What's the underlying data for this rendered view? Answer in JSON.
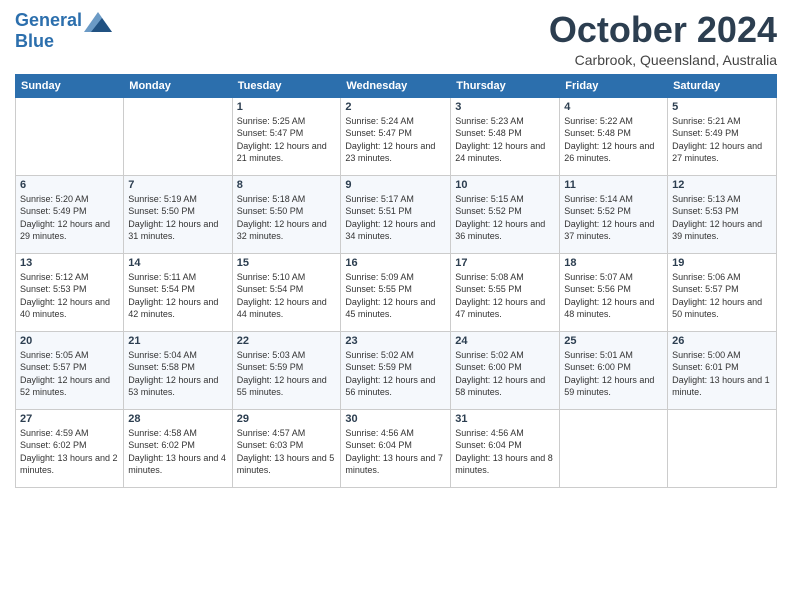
{
  "header": {
    "logo_line1": "General",
    "logo_line2": "Blue",
    "month": "October 2024",
    "location": "Carbrook, Queensland, Australia"
  },
  "weekdays": [
    "Sunday",
    "Monday",
    "Tuesday",
    "Wednesday",
    "Thursday",
    "Friday",
    "Saturday"
  ],
  "weeks": [
    [
      {
        "num": "",
        "info": ""
      },
      {
        "num": "",
        "info": ""
      },
      {
        "num": "1",
        "info": "Sunrise: 5:25 AM\nSunset: 5:47 PM\nDaylight: 12 hours and 21 minutes."
      },
      {
        "num": "2",
        "info": "Sunrise: 5:24 AM\nSunset: 5:47 PM\nDaylight: 12 hours and 23 minutes."
      },
      {
        "num": "3",
        "info": "Sunrise: 5:23 AM\nSunset: 5:48 PM\nDaylight: 12 hours and 24 minutes."
      },
      {
        "num": "4",
        "info": "Sunrise: 5:22 AM\nSunset: 5:48 PM\nDaylight: 12 hours and 26 minutes."
      },
      {
        "num": "5",
        "info": "Sunrise: 5:21 AM\nSunset: 5:49 PM\nDaylight: 12 hours and 27 minutes."
      }
    ],
    [
      {
        "num": "6",
        "info": "Sunrise: 5:20 AM\nSunset: 5:49 PM\nDaylight: 12 hours and 29 minutes."
      },
      {
        "num": "7",
        "info": "Sunrise: 5:19 AM\nSunset: 5:50 PM\nDaylight: 12 hours and 31 minutes."
      },
      {
        "num": "8",
        "info": "Sunrise: 5:18 AM\nSunset: 5:50 PM\nDaylight: 12 hours and 32 minutes."
      },
      {
        "num": "9",
        "info": "Sunrise: 5:17 AM\nSunset: 5:51 PM\nDaylight: 12 hours and 34 minutes."
      },
      {
        "num": "10",
        "info": "Sunrise: 5:15 AM\nSunset: 5:52 PM\nDaylight: 12 hours and 36 minutes."
      },
      {
        "num": "11",
        "info": "Sunrise: 5:14 AM\nSunset: 5:52 PM\nDaylight: 12 hours and 37 minutes."
      },
      {
        "num": "12",
        "info": "Sunrise: 5:13 AM\nSunset: 5:53 PM\nDaylight: 12 hours and 39 minutes."
      }
    ],
    [
      {
        "num": "13",
        "info": "Sunrise: 5:12 AM\nSunset: 5:53 PM\nDaylight: 12 hours and 40 minutes."
      },
      {
        "num": "14",
        "info": "Sunrise: 5:11 AM\nSunset: 5:54 PM\nDaylight: 12 hours and 42 minutes."
      },
      {
        "num": "15",
        "info": "Sunrise: 5:10 AM\nSunset: 5:54 PM\nDaylight: 12 hours and 44 minutes."
      },
      {
        "num": "16",
        "info": "Sunrise: 5:09 AM\nSunset: 5:55 PM\nDaylight: 12 hours and 45 minutes."
      },
      {
        "num": "17",
        "info": "Sunrise: 5:08 AM\nSunset: 5:55 PM\nDaylight: 12 hours and 47 minutes."
      },
      {
        "num": "18",
        "info": "Sunrise: 5:07 AM\nSunset: 5:56 PM\nDaylight: 12 hours and 48 minutes."
      },
      {
        "num": "19",
        "info": "Sunrise: 5:06 AM\nSunset: 5:57 PM\nDaylight: 12 hours and 50 minutes."
      }
    ],
    [
      {
        "num": "20",
        "info": "Sunrise: 5:05 AM\nSunset: 5:57 PM\nDaylight: 12 hours and 52 minutes."
      },
      {
        "num": "21",
        "info": "Sunrise: 5:04 AM\nSunset: 5:58 PM\nDaylight: 12 hours and 53 minutes."
      },
      {
        "num": "22",
        "info": "Sunrise: 5:03 AM\nSunset: 5:59 PM\nDaylight: 12 hours and 55 minutes."
      },
      {
        "num": "23",
        "info": "Sunrise: 5:02 AM\nSunset: 5:59 PM\nDaylight: 12 hours and 56 minutes."
      },
      {
        "num": "24",
        "info": "Sunrise: 5:02 AM\nSunset: 6:00 PM\nDaylight: 12 hours and 58 minutes."
      },
      {
        "num": "25",
        "info": "Sunrise: 5:01 AM\nSunset: 6:00 PM\nDaylight: 12 hours and 59 minutes."
      },
      {
        "num": "26",
        "info": "Sunrise: 5:00 AM\nSunset: 6:01 PM\nDaylight: 13 hours and 1 minute."
      }
    ],
    [
      {
        "num": "27",
        "info": "Sunrise: 4:59 AM\nSunset: 6:02 PM\nDaylight: 13 hours and 2 minutes."
      },
      {
        "num": "28",
        "info": "Sunrise: 4:58 AM\nSunset: 6:02 PM\nDaylight: 13 hours and 4 minutes."
      },
      {
        "num": "29",
        "info": "Sunrise: 4:57 AM\nSunset: 6:03 PM\nDaylight: 13 hours and 5 minutes."
      },
      {
        "num": "30",
        "info": "Sunrise: 4:56 AM\nSunset: 6:04 PM\nDaylight: 13 hours and 7 minutes."
      },
      {
        "num": "31",
        "info": "Sunrise: 4:56 AM\nSunset: 6:04 PM\nDaylight: 13 hours and 8 minutes."
      },
      {
        "num": "",
        "info": ""
      },
      {
        "num": "",
        "info": ""
      }
    ]
  ]
}
